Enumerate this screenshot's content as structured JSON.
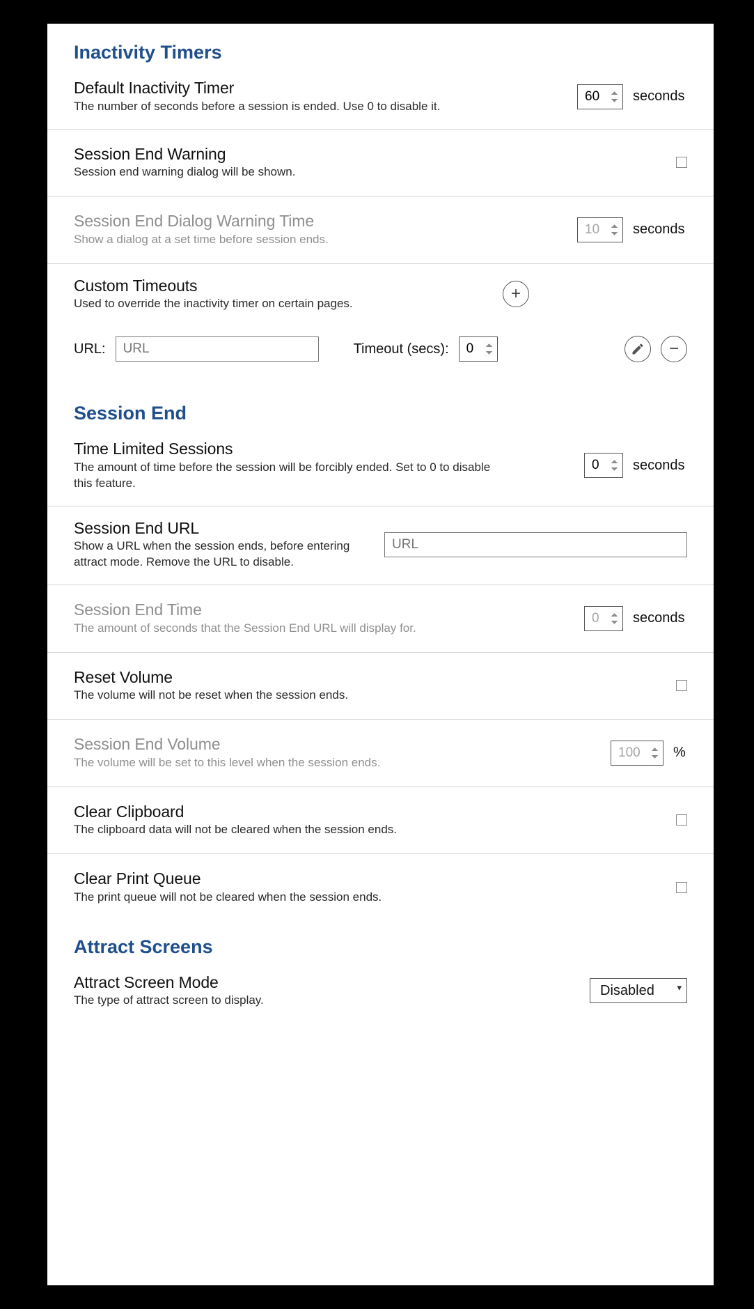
{
  "sections": {
    "inactivity": {
      "title": "Inactivity Timers",
      "default_timer": {
        "label": "Default Inactivity Timer",
        "desc": "The number of seconds before a session is ended.  Use 0 to disable it.",
        "value": "60",
        "unit": "seconds"
      },
      "session_end_warning": {
        "label": "Session End Warning",
        "desc": "Session end warning dialog will be shown.",
        "checked": false
      },
      "dialog_warning_time": {
        "label": "Session End Dialog Warning Time",
        "desc": "Show a dialog at a set time before session ends.",
        "value": "10",
        "unit": "seconds",
        "disabled": true
      },
      "custom_timeouts": {
        "label": "Custom Timeouts",
        "desc": "Used to override the inactivity timer on certain pages.",
        "url_label": "URL:",
        "url_placeholder": "URL",
        "timeout_label": "Timeout (secs):",
        "timeout_value": "0"
      }
    },
    "session_end": {
      "title": "Session End",
      "time_limited": {
        "label": "Time Limited Sessions",
        "desc": "The amount of time before the session will be forcibly ended.  Set to 0 to disable this feature.",
        "value": "0",
        "unit": "seconds"
      },
      "end_url": {
        "label": "Session End URL",
        "desc": "Show a URL when the session ends, before entering attract mode.  Remove the URL to disable.",
        "placeholder": "URL"
      },
      "end_time": {
        "label": "Session End Time",
        "desc": "The amount of seconds that the Session End URL will display for.",
        "value": "0",
        "unit": "seconds",
        "disabled": true
      },
      "reset_volume": {
        "label": "Reset Volume",
        "desc": "The volume will not be reset when the session ends.",
        "checked": false
      },
      "end_volume": {
        "label": "Session End Volume",
        "desc": "The volume will be set to this level when the session ends.",
        "value": "100",
        "unit": "%",
        "disabled": true
      },
      "clear_clipboard": {
        "label": "Clear Clipboard",
        "desc": "The clipboard data will not be cleared when the session ends.",
        "checked": false
      },
      "clear_print": {
        "label": "Clear Print Queue",
        "desc": "The print queue will not be cleared when the session ends.",
        "checked": false
      }
    },
    "attract": {
      "title": "Attract Screens",
      "mode": {
        "label": "Attract Screen Mode",
        "desc": "The type of attract screen to display.",
        "value": "Disabled"
      }
    }
  }
}
